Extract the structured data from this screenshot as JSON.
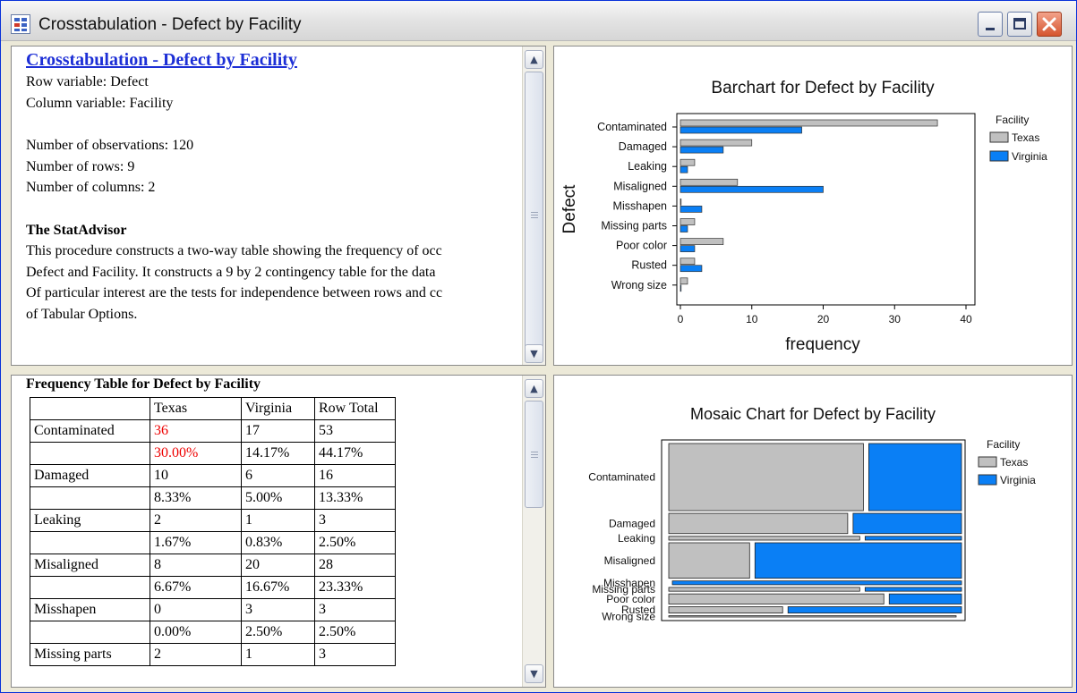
{
  "window": {
    "title": "Crosstabulation - Defect by Facility",
    "buttons": {
      "minimize": "minimize",
      "maximize": "maximize",
      "close": "close"
    }
  },
  "report": {
    "heading": "Crosstabulation - Defect by Facility",
    "row_variable": "Row variable: Defect",
    "column_variable": "Column variable: Facility",
    "observations": "Number of observations: 120",
    "rows": "Number of rows: 9",
    "columns": "Number of columns: 2",
    "advisor_title": "The StatAdvisor",
    "advisor_lines": [
      "This procedure constructs a two-way table showing the frequency of occ",
      "Defect and Facility.  It constructs a 9 by 2 contingency table for the data",
      "Of particular interest are the tests for independence between rows and cc",
      "of Tabular Options."
    ]
  },
  "frequency_table": {
    "title": "Frequency Table for Defect by Facility",
    "headers": [
      "",
      "Texas",
      "Virginia",
      "Row Total"
    ],
    "rows": [
      [
        "Contaminated",
        "36",
        "17",
        "53"
      ],
      [
        "",
        "30.00%",
        "14.17%",
        "44.17%"
      ],
      [
        "Damaged",
        "10",
        "6",
        "16"
      ],
      [
        "",
        "8.33%",
        "5.00%",
        "13.33%"
      ],
      [
        "Leaking",
        "2",
        "1",
        "3"
      ],
      [
        "",
        "1.67%",
        "0.83%",
        "2.50%"
      ],
      [
        "Misaligned",
        "8",
        "20",
        "28"
      ],
      [
        "",
        "6.67%",
        "16.67%",
        "23.33%"
      ],
      [
        "Misshapen",
        "0",
        "3",
        "3"
      ],
      [
        "",
        "0.00%",
        "2.50%",
        "2.50%"
      ],
      [
        "Missing parts",
        "2",
        "1",
        "3"
      ]
    ],
    "highlight_color": "#ee0000"
  },
  "colors": {
    "texas": "#c0c0c0",
    "virginia": "#0a7ff5"
  },
  "chart_data": [
    {
      "type": "bar",
      "orientation": "horizontal",
      "title": "Barchart for Defect by Facility",
      "xlabel": "frequency",
      "ylabel": "Defect",
      "categories": [
        "Contaminated",
        "Damaged",
        "Leaking",
        "Misaligned",
        "Misshapen",
        "Missing parts",
        "Poor color",
        "Rusted",
        "Wrong size"
      ],
      "series": [
        {
          "name": "Texas",
          "values": [
            36,
            10,
            2,
            8,
            0,
            2,
            6,
            2,
            1
          ]
        },
        {
          "name": "Virginia",
          "values": [
            17,
            6,
            1,
            20,
            3,
            1,
            2,
            3,
            0
          ]
        }
      ],
      "xlim": [
        0,
        40
      ],
      "xticks": [
        "0",
        "10",
        "20",
        "30",
        "40"
      ],
      "legend_title": "Facility",
      "legend_position": "top-right"
    },
    {
      "type": "mosaic",
      "title": "Mosaic Chart for Defect by Facility",
      "categories": [
        "Contaminated",
        "Damaged",
        "Leaking",
        "Misaligned",
        "Misshapen",
        "Missing parts",
        "Poor color",
        "Rusted",
        "Wrong size"
      ],
      "series": [
        {
          "name": "Texas",
          "values": [
            36,
            10,
            2,
            8,
            0,
            2,
            6,
            2,
            1
          ]
        },
        {
          "name": "Virginia",
          "values": [
            17,
            6,
            1,
            20,
            3,
            1,
            2,
            3,
            0
          ]
        }
      ],
      "legend_title": "Facility",
      "legend_position": "top-right"
    }
  ]
}
